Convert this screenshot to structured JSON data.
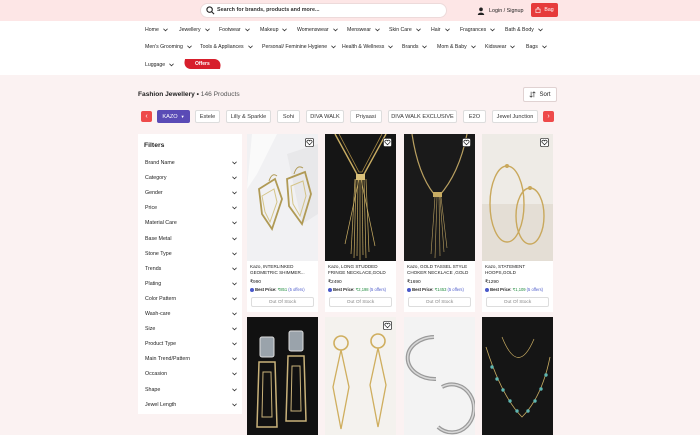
{
  "header": {
    "search_placeholder": "Search for brands, products and more...",
    "login_label": "Login / Signup",
    "bag_label": "Bag"
  },
  "nav": {
    "items": [
      "Home",
      "Jewellery",
      "Footwear",
      "Makeup",
      "Womenswear",
      "Menswear",
      "Skin Care",
      "Hair",
      "Fragrances",
      "Bath & Body",
      "Men's Grooming",
      "Tools & Appliances",
      "Personal/ Feminine Hygiene",
      "Health & Wellness",
      "Brands",
      "Mom & Baby",
      "Kidswear",
      "Bags",
      "Luggage"
    ],
    "offers_label": "Offers"
  },
  "listing": {
    "title": "Fashion Jewellery",
    "count": "146 Products",
    "sort_label": "Sort"
  },
  "brands": [
    "KAZO",
    "Estele",
    "Lilly & Sparkle",
    "Sohi",
    "DIVA WALK",
    "Priyaasi",
    "DIVA WALK EXCLUSIVE",
    "E2O",
    "Jewel Junction"
  ],
  "filters": {
    "heading": "Filters",
    "items": [
      "Brand Name",
      "Category",
      "Gender",
      "Price",
      "Material Care",
      "Base Metal",
      "Stone Type",
      "Trends",
      "Plating",
      "Color Pattern",
      "Wash-care",
      "Size",
      "Product Type",
      "Main Trend/Pattern",
      "Occasion",
      "Shape",
      "Jewel Length"
    ]
  },
  "products": [
    {
      "name": "Kazo, INTERLINKED GEOMETRIC SHIMMER...",
      "price": "₹990",
      "best_prefix": "Best Price:",
      "best_price": "₹851",
      "offers": "(5 offers)",
      "stock": "Out Of Stock"
    },
    {
      "name": "Kazo, LONG STUDDED FRINGE NECKLACE,GOLD",
      "price": "₹2490",
      "best_prefix": "Best Price:",
      "best_price": "₹2,198",
      "offers": "(5 offers)",
      "stock": "Out Of Stock"
    },
    {
      "name": "Kazo, GOLD TASSEL STYLE CHOKER NECKLACE ,GOLD",
      "price": "₹1690",
      "best_prefix": "Best Price:",
      "best_price": "₹1453",
      "offers": "(5 offers)",
      "stock": "Out Of Stock"
    },
    {
      "name": "Kazo, STATEMENT HOOPS,GOLD",
      "price": "₹1290",
      "best_prefix": "Best Price:",
      "best_price": "₹1,109",
      "offers": "(5 offers)",
      "stock": "Out Of Stock"
    }
  ],
  "colors": {
    "accent": "#e63b3b",
    "brand_selected": "#5a4bb6",
    "header_bg": "#fde6e6",
    "offer_green": "#1e8a3c"
  }
}
